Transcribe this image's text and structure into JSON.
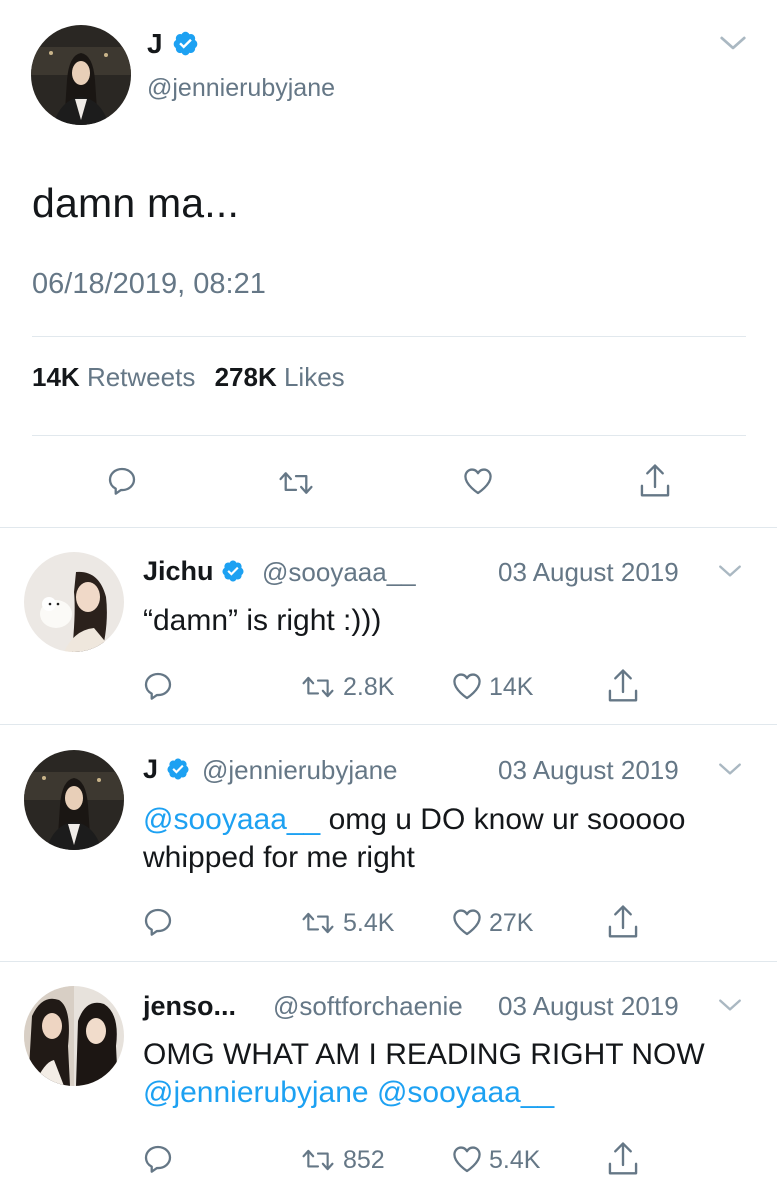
{
  "main_tweet": {
    "name": "J",
    "handle": "@jennierubyjane",
    "text": "damn ma...",
    "timestamp": "06/18/2019, 08:21",
    "retweets_count": "14K",
    "retweets_label": "Retweets",
    "likes_count": "278K",
    "likes_label": "Likes"
  },
  "replies": [
    {
      "name": "Jichu",
      "handle": "@sooyaaa__",
      "date": "03 August 2019",
      "text": "“damn” is right :)))",
      "retweets": "2.8K",
      "likes": "14K"
    },
    {
      "name": "J",
      "handle": "@jennierubyjane",
      "date": "03 August 2019",
      "mention": "@sooyaaa__",
      "text": " omg u DO know ur sooooo whipped for me right",
      "retweets": "5.4K",
      "likes": "27K"
    },
    {
      "name": "jenso...",
      "handle": "@softforchaenie",
      "date": "03 August 2019",
      "text": "OMG WHAT AM I READING RIGHT NOW",
      "mention_1": "@jennierubyjane",
      "mention_2": "@sooyaaa__",
      "retweets": "852",
      "likes": "5.4K"
    }
  ],
  "colors": {
    "accent": "#1da1f2",
    "text": "#14171a",
    "secondary": "#657786",
    "divider": "#e1e8ed"
  },
  "icons": [
    "verified-badge-icon",
    "chevron-down-icon",
    "reply-icon",
    "retweet-icon",
    "like-icon",
    "share-icon"
  ]
}
